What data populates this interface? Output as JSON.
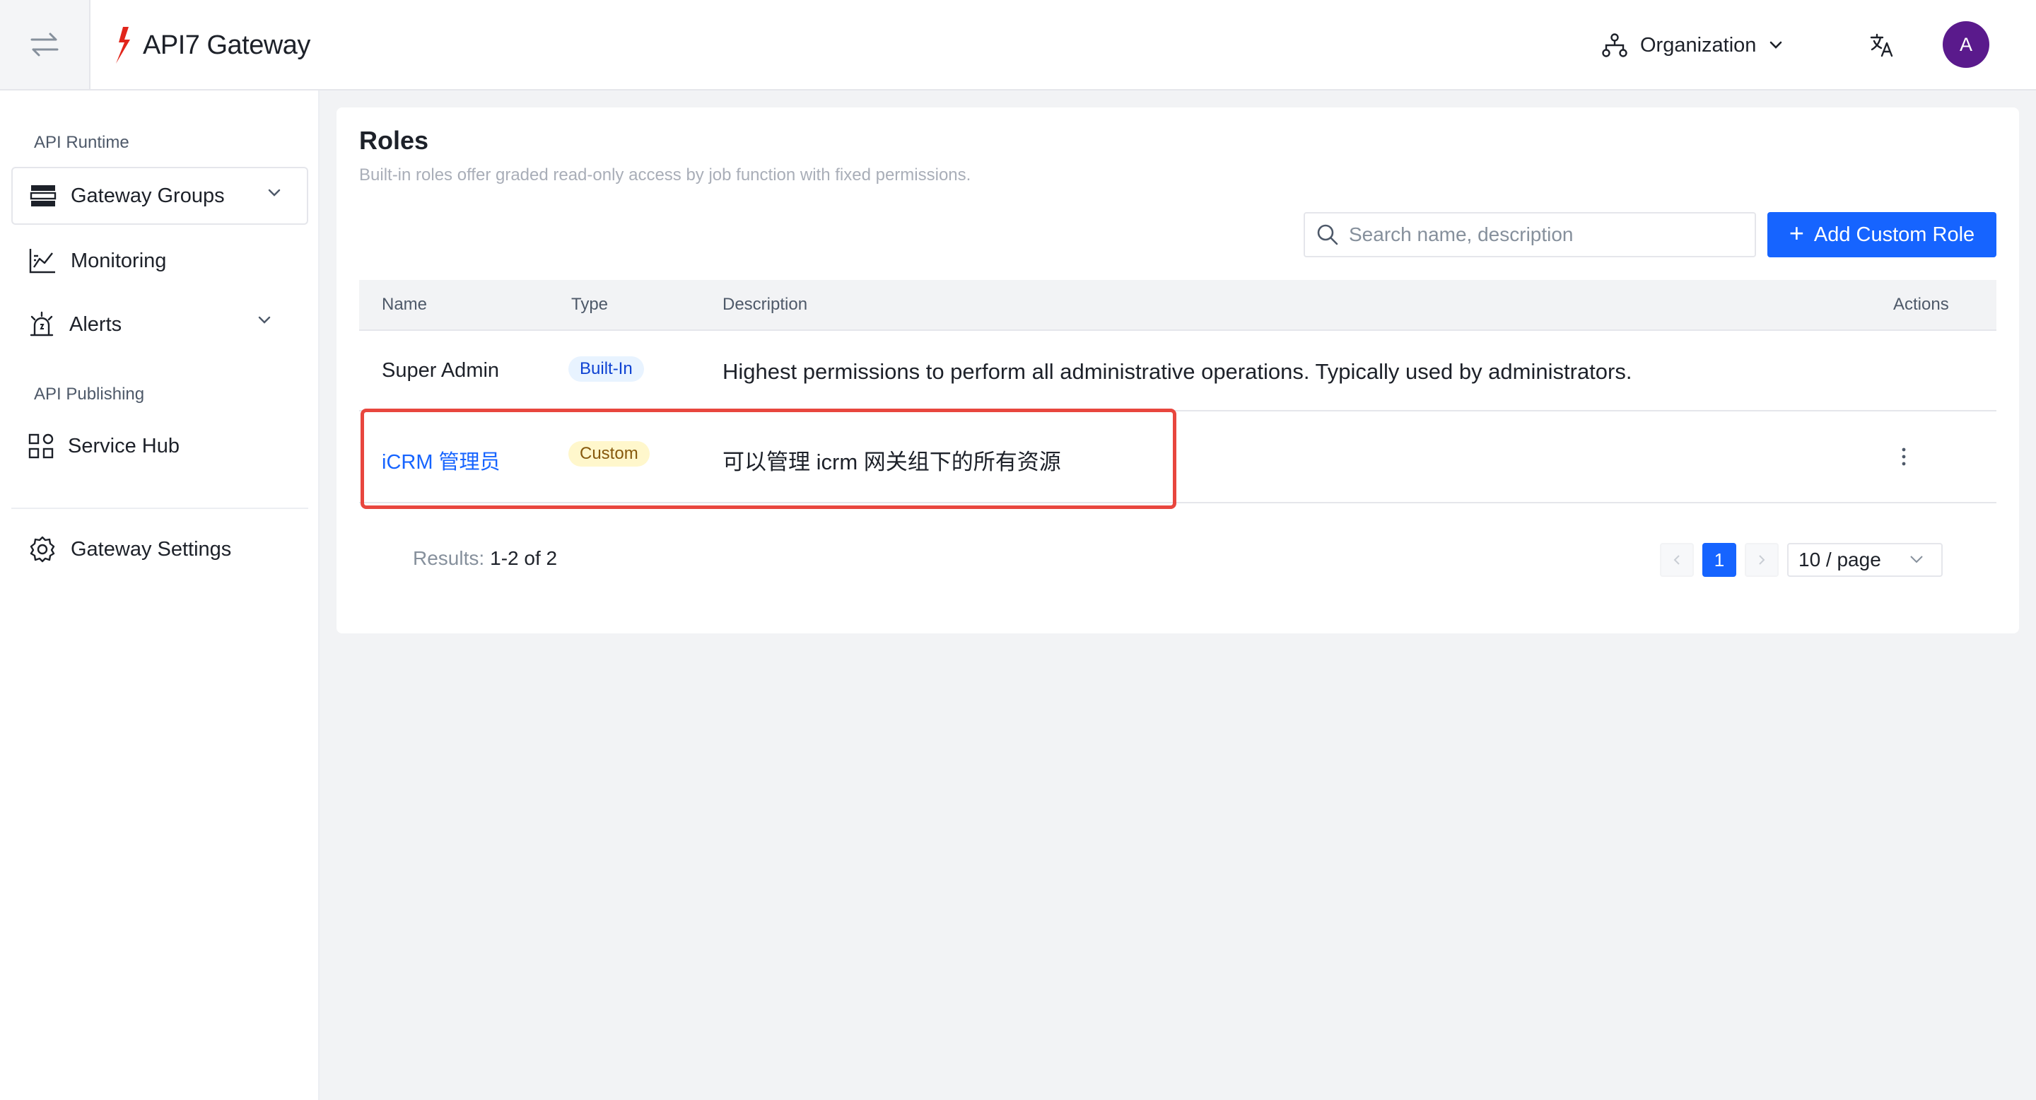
{
  "header": {
    "logo_text": "API7 Gateway",
    "org_label": "Organization",
    "avatar_initial": "A",
    "icons": [
      "swap-arrows-icon",
      "api7-logo-icon",
      "organization-icon",
      "chevron-down-icon",
      "translate-icon"
    ]
  },
  "sidebar": {
    "section_runtime": "API Runtime",
    "section_publishing": "API Publishing",
    "items": [
      {
        "label": "Gateway Groups",
        "icon": "server-icon",
        "has_chevron": true
      },
      {
        "label": "Monitoring",
        "icon": "chart-icon"
      },
      {
        "label": "Alerts",
        "icon": "alarm-icon",
        "has_chevron": true
      },
      {
        "label": "Service Hub",
        "icon": "apps-icon"
      },
      {
        "label": "Gateway Settings",
        "icon": "gear-icon"
      }
    ]
  },
  "main": {
    "title": "Roles",
    "subtitle": "Built-in roles offer graded read-only access by job function with fixed permissions.",
    "search": {
      "placeholder": "Search name, description",
      "value": ""
    },
    "add_button_label": "Add Custom Role",
    "table": {
      "columns": [
        "Name",
        "Type",
        "Description",
        "Actions"
      ],
      "rows": [
        {
          "name": "Super Admin",
          "type": "Built-In",
          "description": "Highest permissions to perform all administrative operations. Typically used by administrators."
        },
        {
          "name": "iCRM 管理员",
          "type": "Custom",
          "description": "可以管理 icrm 网关组下的所有资源",
          "actions_icon": "more-vertical-icon"
        }
      ]
    },
    "pagination": {
      "results_label": "Results:",
      "results_count": "1-2 of 2",
      "current_page": "1",
      "page_size": "10 / page"
    }
  },
  "colors": {
    "primary": "#1664ff",
    "highlight": "#e8463e",
    "avatar_bg": "#5a1a8c",
    "logo_red": "#e1251b"
  }
}
